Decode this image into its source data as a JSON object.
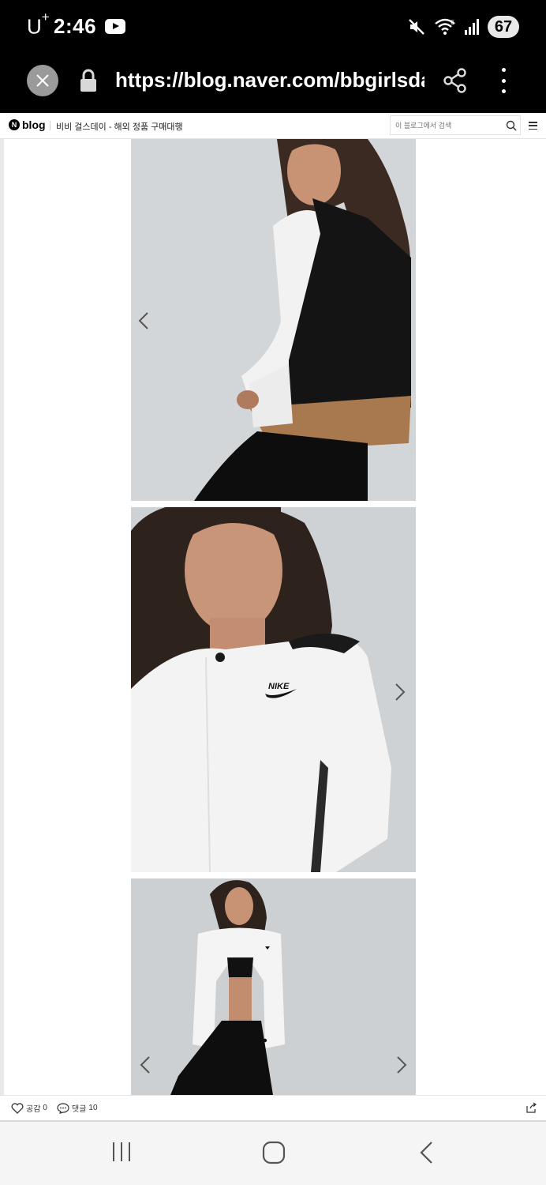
{
  "status_bar": {
    "carrier": "U",
    "carrier_sup": "+",
    "time": "2:46",
    "battery": "67"
  },
  "browser": {
    "url": "https://blog.naver.com/bbgirlsday"
  },
  "blog_header": {
    "logo_letter": "N",
    "logo_word": "blog",
    "blog_title": "비비 걸스데이 - 해외 정품 구매대행",
    "search_placeholder": "이 블로그에서 검색"
  },
  "photos": [
    {
      "label": "Nike jacket back view"
    },
    {
      "label": "Nike jacket front closeup",
      "logo_text": "NIKE"
    },
    {
      "label": "Nike jacket full body"
    }
  ],
  "footer": {
    "like_label": "공감",
    "like_count": "0",
    "comment_label": "댓글",
    "comment_count": "10"
  },
  "colors": {
    "background": "#ffffff",
    "status_bar": "#000000",
    "nav_bar": "#f5f5f5"
  },
  "icons": [
    "youtube-icon",
    "mute-icon",
    "wifi-icon",
    "signal-icon",
    "close-icon",
    "lock-icon",
    "share-icon",
    "more-icon",
    "search-icon",
    "menu-icon",
    "chevron-left-icon",
    "chevron-right-icon",
    "heart-icon",
    "comment-icon",
    "recent-apps-icon",
    "home-icon",
    "back-icon"
  ]
}
